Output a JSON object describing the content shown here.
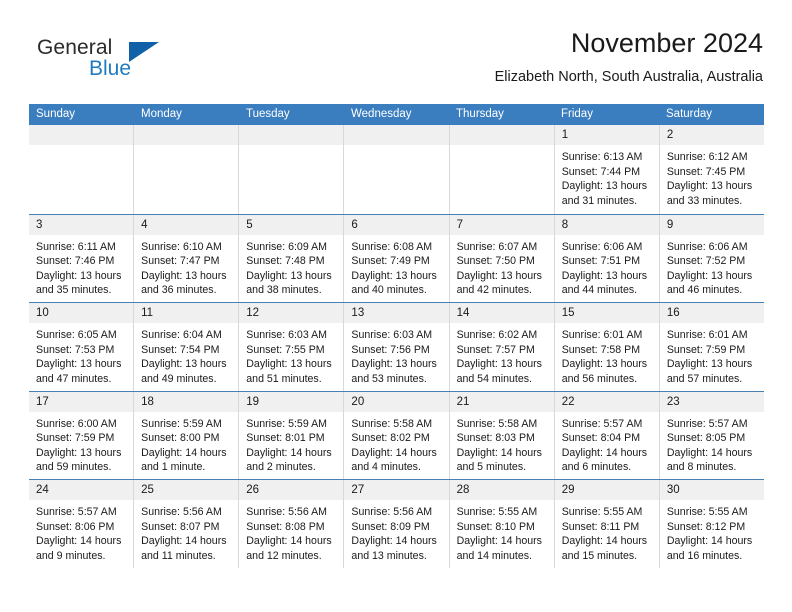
{
  "logo": {
    "word_top": "General",
    "word_bottom": "Blue",
    "triangle_color": "#1161a8",
    "blue_color": "#1f7bc1"
  },
  "header": {
    "title": "November 2024",
    "subtitle": "Elizabeth North, South Australia, Australia"
  },
  "theme": {
    "header_bar": "#3b7ec0",
    "row_divider": "#4a7fb5",
    "day_band": "#f0f0f0",
    "cell_divider": "#d8d8d8"
  },
  "weekdays": [
    "Sunday",
    "Monday",
    "Tuesday",
    "Wednesday",
    "Thursday",
    "Friday",
    "Saturday"
  ],
  "weeks": [
    [
      {
        "day": "",
        "lines": []
      },
      {
        "day": "",
        "lines": []
      },
      {
        "day": "",
        "lines": []
      },
      {
        "day": "",
        "lines": []
      },
      {
        "day": "",
        "lines": []
      },
      {
        "day": "1",
        "lines": [
          "Sunrise: 6:13 AM",
          "Sunset: 7:44 PM",
          "Daylight: 13 hours",
          "and 31 minutes."
        ]
      },
      {
        "day": "2",
        "lines": [
          "Sunrise: 6:12 AM",
          "Sunset: 7:45 PM",
          "Daylight: 13 hours",
          "and 33 minutes."
        ]
      }
    ],
    [
      {
        "day": "3",
        "lines": [
          "Sunrise: 6:11 AM",
          "Sunset: 7:46 PM",
          "Daylight: 13 hours",
          "and 35 minutes."
        ]
      },
      {
        "day": "4",
        "lines": [
          "Sunrise: 6:10 AM",
          "Sunset: 7:47 PM",
          "Daylight: 13 hours",
          "and 36 minutes."
        ]
      },
      {
        "day": "5",
        "lines": [
          "Sunrise: 6:09 AM",
          "Sunset: 7:48 PM",
          "Daylight: 13 hours",
          "and 38 minutes."
        ]
      },
      {
        "day": "6",
        "lines": [
          "Sunrise: 6:08 AM",
          "Sunset: 7:49 PM",
          "Daylight: 13 hours",
          "and 40 minutes."
        ]
      },
      {
        "day": "7",
        "lines": [
          "Sunrise: 6:07 AM",
          "Sunset: 7:50 PM",
          "Daylight: 13 hours",
          "and 42 minutes."
        ]
      },
      {
        "day": "8",
        "lines": [
          "Sunrise: 6:06 AM",
          "Sunset: 7:51 PM",
          "Daylight: 13 hours",
          "and 44 minutes."
        ]
      },
      {
        "day": "9",
        "lines": [
          "Sunrise: 6:06 AM",
          "Sunset: 7:52 PM",
          "Daylight: 13 hours",
          "and 46 minutes."
        ]
      }
    ],
    [
      {
        "day": "10",
        "lines": [
          "Sunrise: 6:05 AM",
          "Sunset: 7:53 PM",
          "Daylight: 13 hours",
          "and 47 minutes."
        ]
      },
      {
        "day": "11",
        "lines": [
          "Sunrise: 6:04 AM",
          "Sunset: 7:54 PM",
          "Daylight: 13 hours",
          "and 49 minutes."
        ]
      },
      {
        "day": "12",
        "lines": [
          "Sunrise: 6:03 AM",
          "Sunset: 7:55 PM",
          "Daylight: 13 hours",
          "and 51 minutes."
        ]
      },
      {
        "day": "13",
        "lines": [
          "Sunrise: 6:03 AM",
          "Sunset: 7:56 PM",
          "Daylight: 13 hours",
          "and 53 minutes."
        ]
      },
      {
        "day": "14",
        "lines": [
          "Sunrise: 6:02 AM",
          "Sunset: 7:57 PM",
          "Daylight: 13 hours",
          "and 54 minutes."
        ]
      },
      {
        "day": "15",
        "lines": [
          "Sunrise: 6:01 AM",
          "Sunset: 7:58 PM",
          "Daylight: 13 hours",
          "and 56 minutes."
        ]
      },
      {
        "day": "16",
        "lines": [
          "Sunrise: 6:01 AM",
          "Sunset: 7:59 PM",
          "Daylight: 13 hours",
          "and 57 minutes."
        ]
      }
    ],
    [
      {
        "day": "17",
        "lines": [
          "Sunrise: 6:00 AM",
          "Sunset: 7:59 PM",
          "Daylight: 13 hours",
          "and 59 minutes."
        ]
      },
      {
        "day": "18",
        "lines": [
          "Sunrise: 5:59 AM",
          "Sunset: 8:00 PM",
          "Daylight: 14 hours",
          "and 1 minute."
        ]
      },
      {
        "day": "19",
        "lines": [
          "Sunrise: 5:59 AM",
          "Sunset: 8:01 PM",
          "Daylight: 14 hours",
          "and 2 minutes."
        ]
      },
      {
        "day": "20",
        "lines": [
          "Sunrise: 5:58 AM",
          "Sunset: 8:02 PM",
          "Daylight: 14 hours",
          "and 4 minutes."
        ]
      },
      {
        "day": "21",
        "lines": [
          "Sunrise: 5:58 AM",
          "Sunset: 8:03 PM",
          "Daylight: 14 hours",
          "and 5 minutes."
        ]
      },
      {
        "day": "22",
        "lines": [
          "Sunrise: 5:57 AM",
          "Sunset: 8:04 PM",
          "Daylight: 14 hours",
          "and 6 minutes."
        ]
      },
      {
        "day": "23",
        "lines": [
          "Sunrise: 5:57 AM",
          "Sunset: 8:05 PM",
          "Daylight: 14 hours",
          "and 8 minutes."
        ]
      }
    ],
    [
      {
        "day": "24",
        "lines": [
          "Sunrise: 5:57 AM",
          "Sunset: 8:06 PM",
          "Daylight: 14 hours",
          "and 9 minutes."
        ]
      },
      {
        "day": "25",
        "lines": [
          "Sunrise: 5:56 AM",
          "Sunset: 8:07 PM",
          "Daylight: 14 hours",
          "and 11 minutes."
        ]
      },
      {
        "day": "26",
        "lines": [
          "Sunrise: 5:56 AM",
          "Sunset: 8:08 PM",
          "Daylight: 14 hours",
          "and 12 minutes."
        ]
      },
      {
        "day": "27",
        "lines": [
          "Sunrise: 5:56 AM",
          "Sunset: 8:09 PM",
          "Daylight: 14 hours",
          "and 13 minutes."
        ]
      },
      {
        "day": "28",
        "lines": [
          "Sunrise: 5:55 AM",
          "Sunset: 8:10 PM",
          "Daylight: 14 hours",
          "and 14 minutes."
        ]
      },
      {
        "day": "29",
        "lines": [
          "Sunrise: 5:55 AM",
          "Sunset: 8:11 PM",
          "Daylight: 14 hours",
          "and 15 minutes."
        ]
      },
      {
        "day": "30",
        "lines": [
          "Sunrise: 5:55 AM",
          "Sunset: 8:12 PM",
          "Daylight: 14 hours",
          "and 16 minutes."
        ]
      }
    ]
  ]
}
